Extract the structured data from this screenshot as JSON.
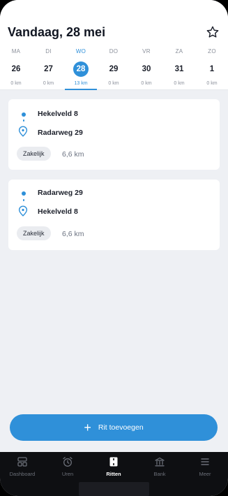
{
  "header": {
    "title": "Vandaag, 28 mei",
    "favorite_icon": "star-outline-icon"
  },
  "days": [
    {
      "dow": "MA",
      "num": "26",
      "km": "0 km",
      "active": false
    },
    {
      "dow": "DI",
      "num": "27",
      "km": "0 km",
      "active": false
    },
    {
      "dow": "WO",
      "num": "28",
      "km": "13 km",
      "active": true
    },
    {
      "dow": "DO",
      "num": "29",
      "km": "0 km",
      "active": false
    },
    {
      "dow": "VR",
      "num": "30",
      "km": "0 km",
      "active": false
    },
    {
      "dow": "ZA",
      "num": "31",
      "km": "0 km",
      "active": false
    },
    {
      "dow": "ZO",
      "num": "1",
      "km": "0 km",
      "active": false
    }
  ],
  "trips": [
    {
      "from": "Hekelveld 8",
      "to": "Radarweg 29",
      "type": "Zakelijk",
      "distance": "6,6 km"
    },
    {
      "from": "Radarweg 29",
      "to": "Hekelveld 8",
      "type": "Zakelijk",
      "distance": "6,6 km"
    }
  ],
  "add_button": {
    "label": "Rit toevoegen",
    "icon": "plus-icon"
  },
  "nav": [
    {
      "label": "Dashboard",
      "icon": "dashboard-icon",
      "active": false
    },
    {
      "label": "Uren",
      "icon": "alarm-clock-icon",
      "active": false
    },
    {
      "label": "Ritten",
      "icon": "road-icon",
      "active": true
    },
    {
      "label": "Bank",
      "icon": "bank-icon",
      "active": false
    },
    {
      "label": "Meer",
      "icon": "menu-icon",
      "active": false
    }
  ],
  "colors": {
    "accent": "#2f90d9",
    "background": "#eef0f4",
    "nav_background": "#0e0f12"
  }
}
